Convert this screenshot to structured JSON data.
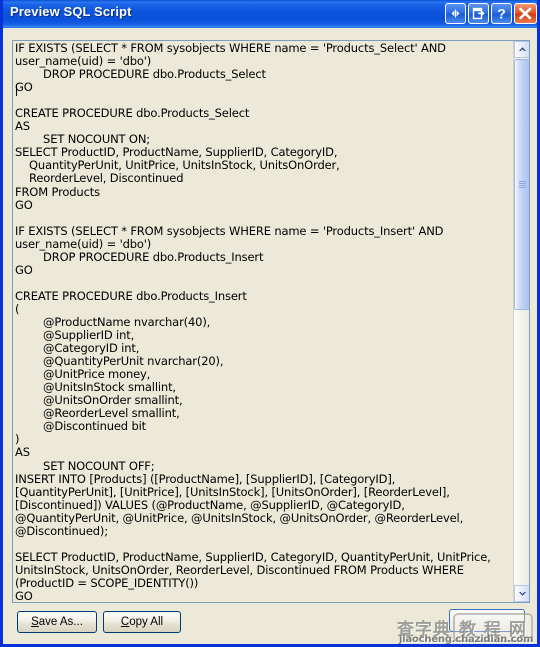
{
  "window": {
    "title": "Preview SQL Script",
    "titlebar_buttons": [
      {
        "name": "resize-restore-button",
        "icon": "left-right-arrow-icon",
        "label": ""
      },
      {
        "name": "maximize-restore-button",
        "icon": "restore-window-icon",
        "label": ""
      },
      {
        "name": "help-button",
        "icon": "question-mark-icon",
        "label": "?"
      },
      {
        "name": "close-window-button",
        "icon": "close-x-icon",
        "label": "X"
      }
    ],
    "colors": {
      "titlebar_blue": "#0a52d6",
      "window_face": "#ece9d8",
      "close_red": "#cf3c12",
      "border_blue": "#0831d9",
      "textbox_border": "#7f9db9"
    }
  },
  "script": {
    "content": "IF EXISTS (SELECT * FROM sysobjects WHERE name = 'Products_Select' AND user_name(uid) = 'dbo')\n\tDROP PROCEDURE dbo.Products_Select\nGO\n\nCREATE PROCEDURE dbo.Products_Select\nAS\n\tSET NOCOUNT ON;\nSELECT ProductID, ProductName, SupplierID, CategoryID,\n    QuantityPerUnit, UnitPrice, UnitsInStock, UnitsOnOrder,\n    ReorderLevel, Discontinued\nFROM Products\nGO\n\nIF EXISTS (SELECT * FROM sysobjects WHERE name = 'Products_Insert' AND user_name(uid) = 'dbo')\n\tDROP PROCEDURE dbo.Products_Insert\nGO\n\nCREATE PROCEDURE dbo.Products_Insert\n(\n\t@ProductName nvarchar(40),\n\t@SupplierID int,\n\t@CategoryID int,\n\t@QuantityPerUnit nvarchar(20),\n\t@UnitPrice money,\n\t@UnitsInStock smallint,\n\t@UnitsOnOrder smallint,\n\t@ReorderLevel smallint,\n\t@Discontinued bit\n)\nAS\n\tSET NOCOUNT OFF;\nINSERT INTO [Products] ([ProductName], [SupplierID], [CategoryID], [QuantityPerUnit], [UnitPrice], [UnitsInStock], [UnitsOnOrder], [ReorderLevel], [Discontinued]) VALUES (@ProductName, @SupplierID, @CategoryID, @QuantityPerUnit, @UnitPrice, @UnitsInStock, @UnitsOnOrder, @ReorderLevel, @Discontinued);\n\nSELECT ProductID, ProductName, SupplierID, CategoryID, QuantityPerUnit, UnitPrice, UnitsInStock, UnitsOnOrder, ReorderLevel, Discontinued FROM Products WHERE (ProductID = SCOPE_IDENTITY())\nGO"
  },
  "scrollbar": {
    "up_arrow": "▲",
    "down_arrow": "▼"
  },
  "buttons": {
    "save_as": {
      "label": "Save As...",
      "accel": "S",
      "rest": "ave As..."
    },
    "copy_all": {
      "label": "Copy All",
      "accel": "C",
      "rest": "opy All"
    },
    "close": {
      "label": ""
    }
  },
  "watermark": {
    "cn_left": "查字典",
    "cn_right": "教 程 网",
    "url": "jiaocheng.chazidian.com"
  }
}
